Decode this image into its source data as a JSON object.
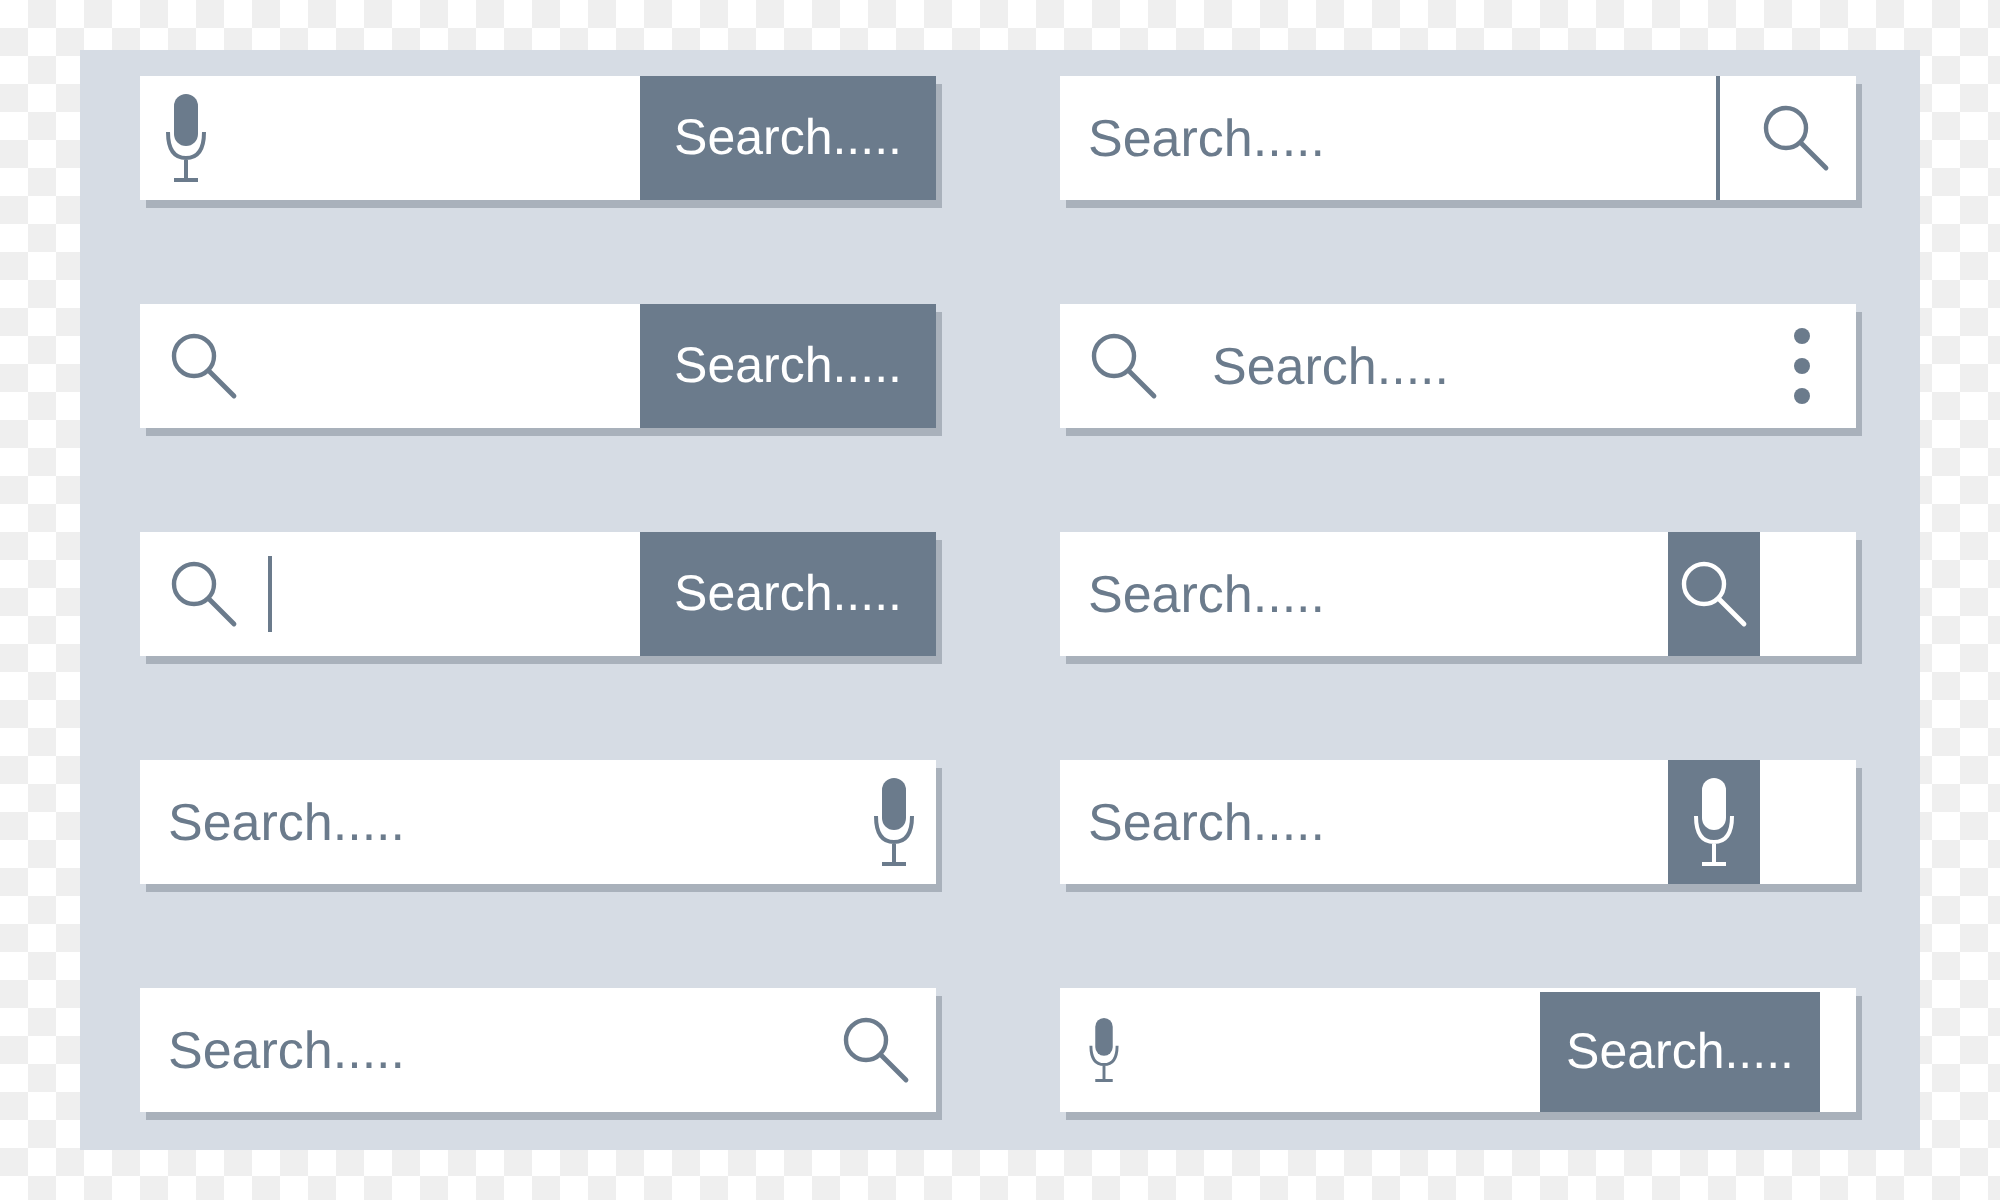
{
  "search_bars": [
    {
      "parts": [
        {
          "kind": "mic"
        },
        {
          "kind": "button",
          "text": "Search.....",
          "inset": false
        }
      ]
    },
    {
      "parts": [
        {
          "kind": "placeholder",
          "placeholder": "Search....."
        },
        {
          "kind": "divider"
        },
        {
          "kind": "search"
        }
      ]
    },
    {
      "parts": [
        {
          "kind": "search"
        },
        {
          "kind": "button",
          "text": "Search.....",
          "inset": false
        }
      ]
    },
    {
      "parts": [
        {
          "kind": "search"
        },
        {
          "kind": "placeholder",
          "placeholder": "Search....."
        },
        {
          "kind": "kebab"
        }
      ]
    },
    {
      "parts": [
        {
          "kind": "search"
        },
        {
          "kind": "cursor"
        },
        {
          "kind": "button",
          "text": "Search.....",
          "inset": false
        }
      ]
    },
    {
      "parts": [
        {
          "kind": "placeholder",
          "placeholder": "Search....."
        },
        {
          "kind": "search-box"
        }
      ]
    },
    {
      "parts": [
        {
          "kind": "placeholder",
          "placeholder": "Search....."
        },
        {
          "kind": "mic"
        }
      ]
    },
    {
      "parts": [
        {
          "kind": "placeholder",
          "placeholder": "Search....."
        },
        {
          "kind": "mic-box"
        }
      ]
    },
    {
      "parts": [
        {
          "kind": "placeholder",
          "placeholder": "Search....."
        },
        {
          "kind": "search"
        }
      ]
    },
    {
      "parts": [
        {
          "kind": "mic",
          "small": true
        },
        {
          "kind": "button",
          "text": "Search.....",
          "inset": true
        }
      ]
    }
  ]
}
